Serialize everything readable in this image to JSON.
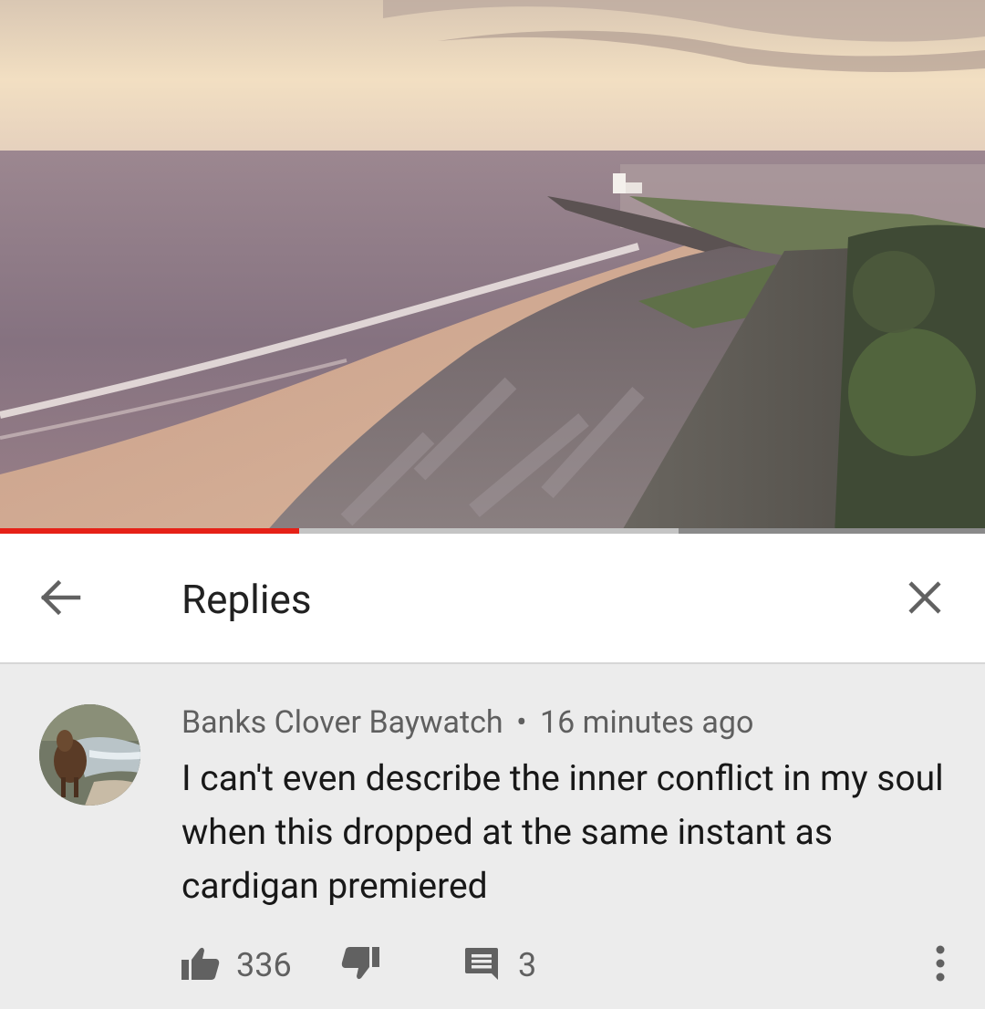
{
  "player": {
    "scene": "coastal sunset beach with rocky breakwater and lighthouse",
    "progress_fraction": 0.304,
    "buffered_fraction": 0.689,
    "colors": {
      "played": "#e62117",
      "buffered": "#c4c4c4",
      "track": "#8a8a8a"
    }
  },
  "header": {
    "title": "Replies",
    "back_icon": "arrow-left-icon",
    "close_icon": "close-icon"
  },
  "comment": {
    "author": "Banks Clover Baywatch",
    "separator": "•",
    "time": "16 minutes ago",
    "text": "I can't even describe the inner conflict in my soul when this dropped at the same instant as cardigan premiered",
    "likes": "336",
    "replies": "3",
    "icons": {
      "like": "thumbs-up-icon",
      "dislike": "thumbs-down-icon",
      "reply": "reply-comment-icon",
      "more": "more-vertical-icon"
    }
  }
}
